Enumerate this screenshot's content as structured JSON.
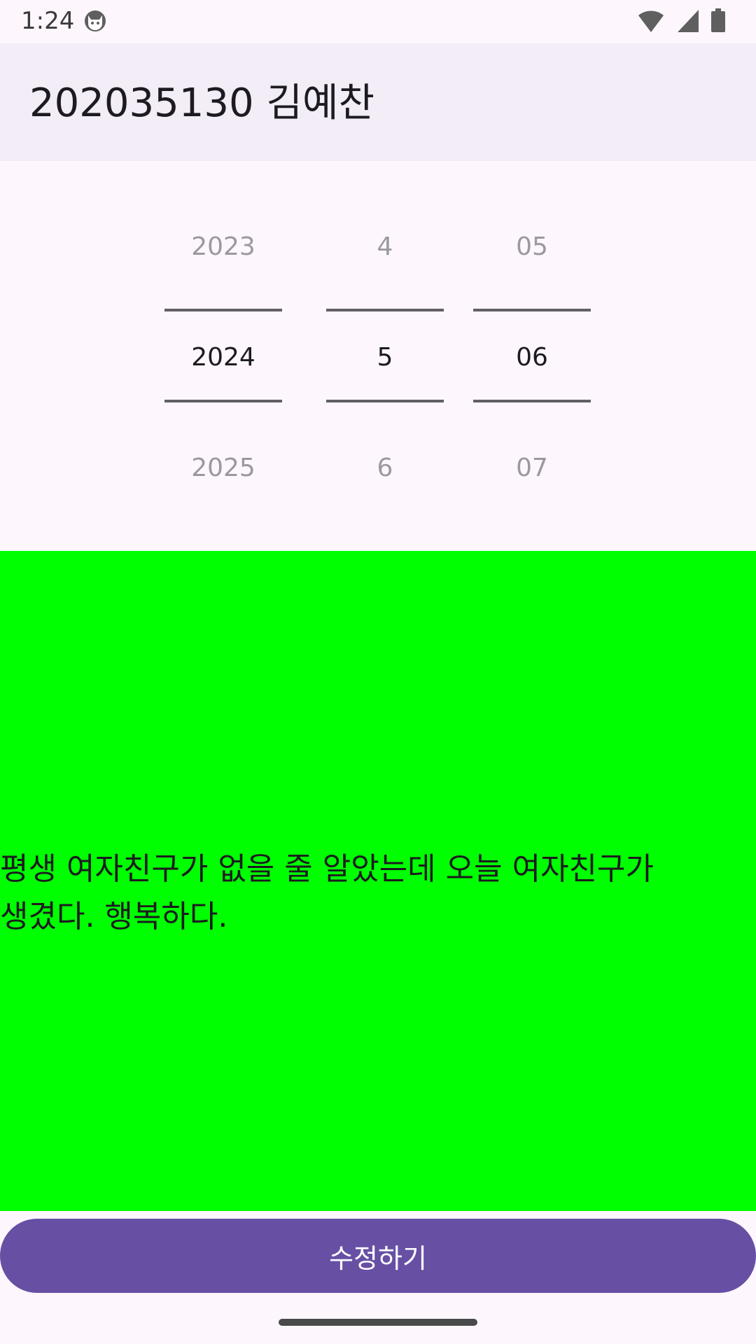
{
  "status_bar": {
    "time": "1:24",
    "icons": [
      "app-notification-icon",
      "wifi-icon",
      "cellular-signal-icon",
      "battery-icon"
    ]
  },
  "app_bar": {
    "title": "202035130 김예찬"
  },
  "date_picker": {
    "year": {
      "prev": "2023",
      "selected": "2024",
      "next": "2025"
    },
    "month": {
      "prev": "4",
      "selected": "5",
      "next": "6"
    },
    "day": {
      "prev": "05",
      "selected": "06",
      "next": "07"
    }
  },
  "content": {
    "text": "평생 여자친구가 없을 줄 알았는데 오늘 여자친구가 생겼다. 행복하다.",
    "background_color": "#00ff00"
  },
  "edit_button": {
    "label": "수정하기",
    "color": "#6750a4"
  }
}
